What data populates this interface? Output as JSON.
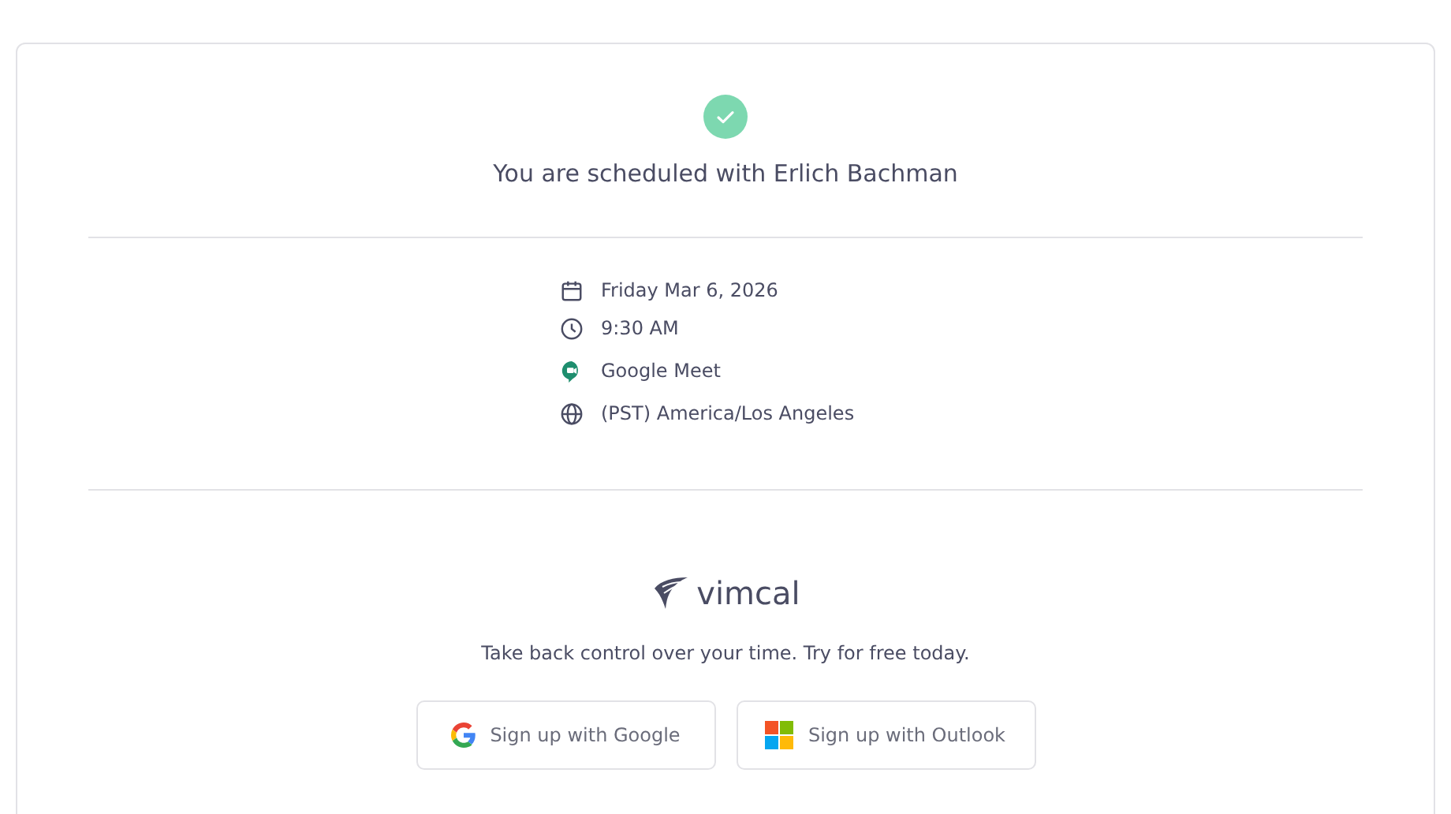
{
  "confirmation": {
    "title": "You are scheduled with Erlich Bachman"
  },
  "details": [
    {
      "kind": "date",
      "text": "Friday Mar 6, 2026"
    },
    {
      "kind": "time",
      "text": "9:30 AM"
    },
    {
      "kind": "meet",
      "text": "Google Meet"
    },
    {
      "kind": "timezone",
      "text": "(PST) America/Los Angeles"
    }
  ],
  "promo": {
    "brand": "vimcal",
    "tagline": "Take back control over your time. Try for free today.",
    "buttons": [
      {
        "kind": "google",
        "label": "Sign up with Google"
      },
      {
        "kind": "outlook",
        "label": "Sign up with Outlook"
      }
    ]
  }
}
